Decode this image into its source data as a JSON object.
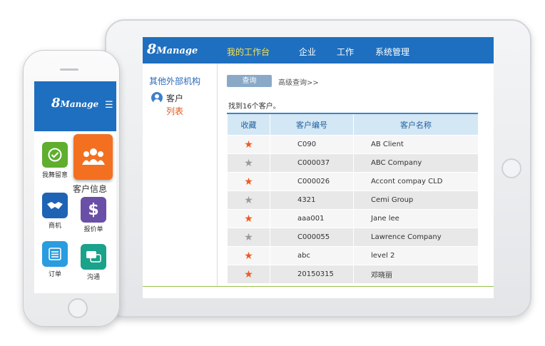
{
  "tablet": {
    "logo": {
      "digit": "8",
      "word": "Manage"
    },
    "nav": [
      "我的工作台",
      "企业",
      "工作",
      "系统管理"
    ],
    "sidebar": {
      "title": "其他外部机构",
      "customer": "客户",
      "list": "列表"
    },
    "query_button": "查询",
    "advanced_query": "高级查询>>",
    "found_text": "找到16个客户。",
    "table": {
      "headers": [
        "收藏",
        "客户编号",
        "客户名称"
      ],
      "rows": [
        {
          "starred": true,
          "star": "★",
          "id": "C090",
          "name": "AB Client"
        },
        {
          "starred": false,
          "star": "★",
          "id": "C000037",
          "name": "ABC Company"
        },
        {
          "starred": true,
          "star": "★",
          "id": "C000026",
          "name": "Accont compay CLD"
        },
        {
          "starred": false,
          "star": "★",
          "id": "4321",
          "name": "Cemi Group"
        },
        {
          "starred": true,
          "star": "★",
          "id": "aaa001",
          "name": "Jane lee"
        },
        {
          "starred": false,
          "star": "★",
          "id": "C000055",
          "name": "Lawrence Company"
        },
        {
          "starred": true,
          "star": "★",
          "id": "abc",
          "name": "level 2"
        },
        {
          "starred": true,
          "star": "★",
          "id": "20150315",
          "name": "邓晓丽"
        }
      ]
    },
    "colors": {
      "topbar": "#1e6fbf",
      "active_nav": "#ffe14a",
      "star_on": "#ee5a24",
      "star_off": "#9a9a9a"
    }
  },
  "phone": {
    "logo": {
      "digit": "8",
      "word": "Manage"
    },
    "menu_icon": "menu-icon",
    "tiles": [
      {
        "name": "check-icon",
        "label": "我舞留意",
        "color": "#5fae2e"
      },
      {
        "name": "handshake-icon",
        "label": "商机",
        "color": "#1f63b5"
      },
      {
        "name": "dollar-icon",
        "label": "报价单",
        "color": "#6a4fa6"
      },
      {
        "name": "list-icon",
        "label": "订单",
        "color": "#2a9ce0"
      },
      {
        "name": "chat-icon",
        "label": "沟通",
        "color": "#1aa28a"
      }
    ],
    "featured": {
      "name": "customers-icon",
      "label": "客户信息",
      "color": "#f37021"
    }
  }
}
